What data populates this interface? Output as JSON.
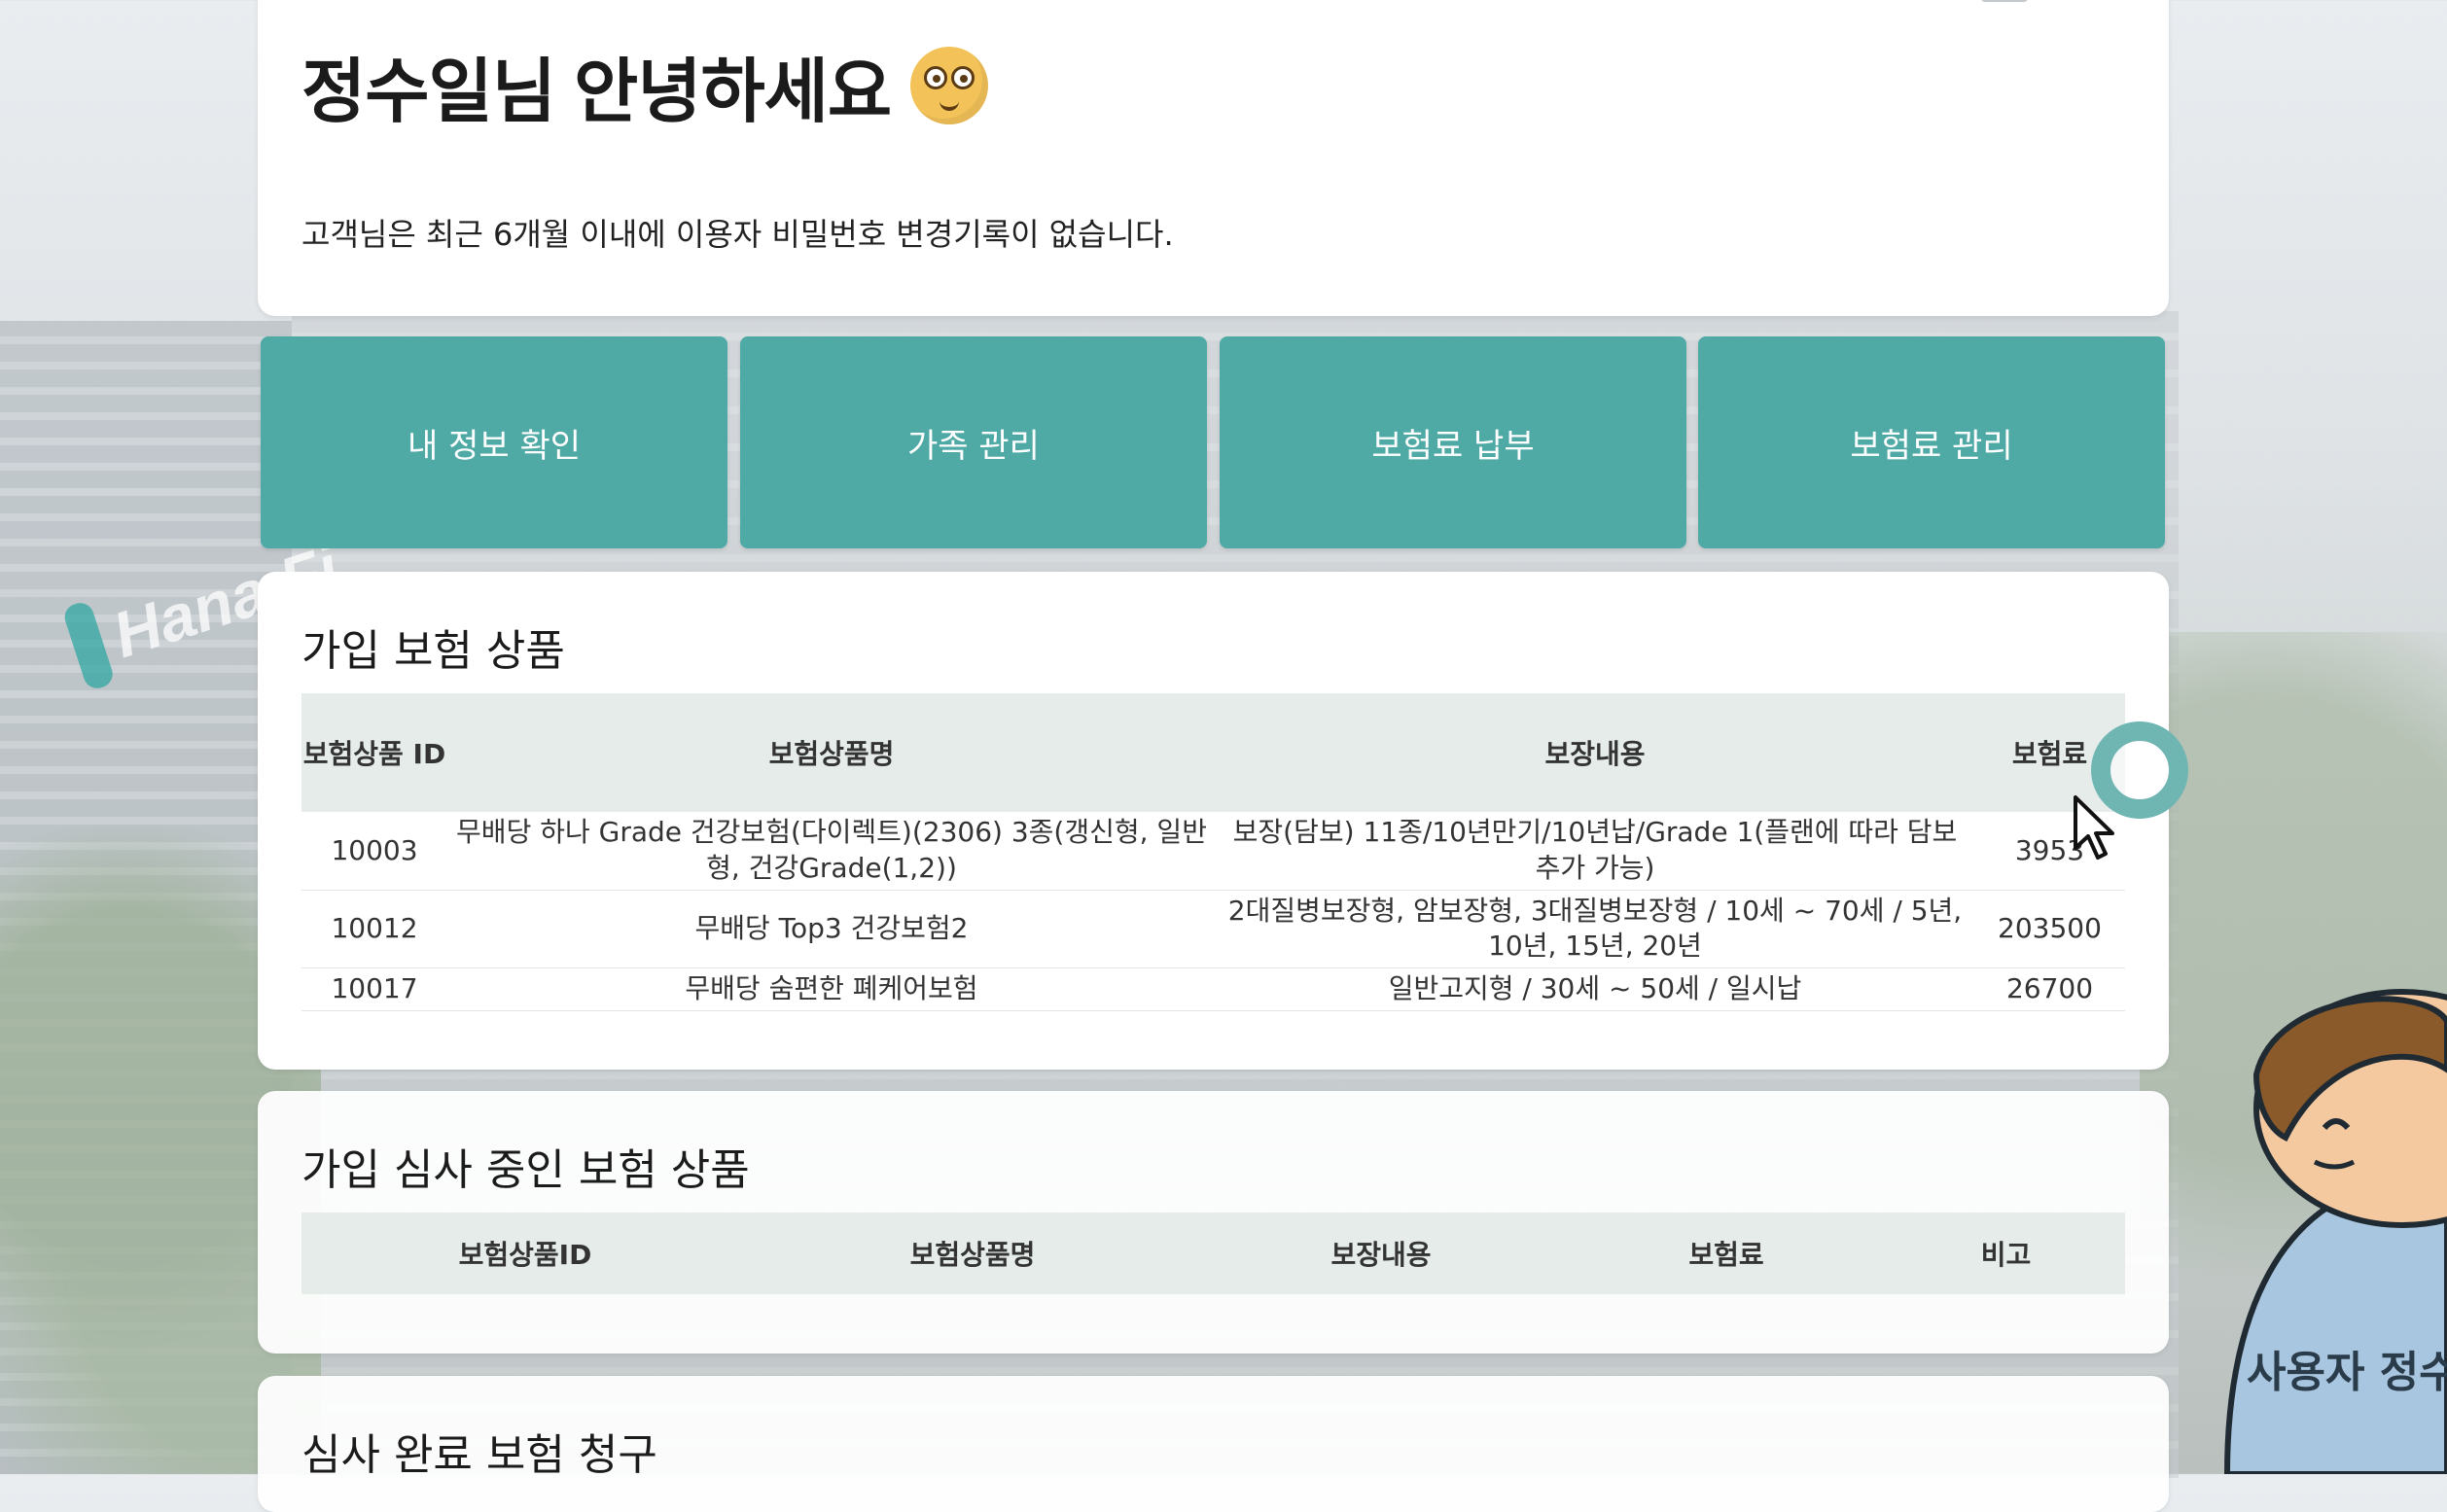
{
  "greeting": {
    "title": "정수일님 안녕하세요",
    "notice": "고객님은 최근 6개월 이내에 이용자 비밀번호 변경기록이 없습니다."
  },
  "background": {
    "logo_text": "Hana Fi"
  },
  "nav": {
    "my_info": "내 정보 확인",
    "family": "가족 관리",
    "payment": "보험료 납부",
    "premium_manage": "보험료 관리"
  },
  "enrolled": {
    "title": "가입 보험 상품",
    "headers": [
      "보험상품 ID",
      "보험상품명",
      "보장내용",
      "보험료"
    ],
    "rows": [
      [
        "10003",
        "무배당 하나 Grade 건강보험(다이렉트)(2306) 3종(갱신형, 일반형, 건강Grade(1,2))",
        "보장(담보) 11종/10년만기/10년납/Grade 1(플랜에 따라 담보 추가 가능)",
        "3953"
      ],
      [
        "10012",
        "무배당 Top3 건강보험2",
        "2대질병보장형, 암보장형, 3대질병보장형 / 10세 ~ 70세 / 5년, 10년, 15년, 20년",
        "203500"
      ],
      [
        "10017",
        "무배당 숨편한 폐케어보험",
        "일반고지형 / 30세 ~ 50세 / 일시납",
        "26700"
      ]
    ]
  },
  "review": {
    "title": "가입 심사 중인 보험 상품",
    "headers": [
      "보험상품ID",
      "보험상품명",
      "보장내용",
      "보험료",
      "비고"
    ]
  },
  "claims": {
    "title": "심사 완료 보험 청구"
  },
  "avatar": {
    "label": "사용자 정수일"
  },
  "icons": [
    "mail-icon",
    "bell-icon",
    "smiley-emoji-icon",
    "loading-spinner-icon",
    "mouse-pointer-icon"
  ],
  "colors": {
    "tile": "#4faaa6",
    "header_bg": "#e5ecea",
    "spinner": "#6fb5b2"
  }
}
